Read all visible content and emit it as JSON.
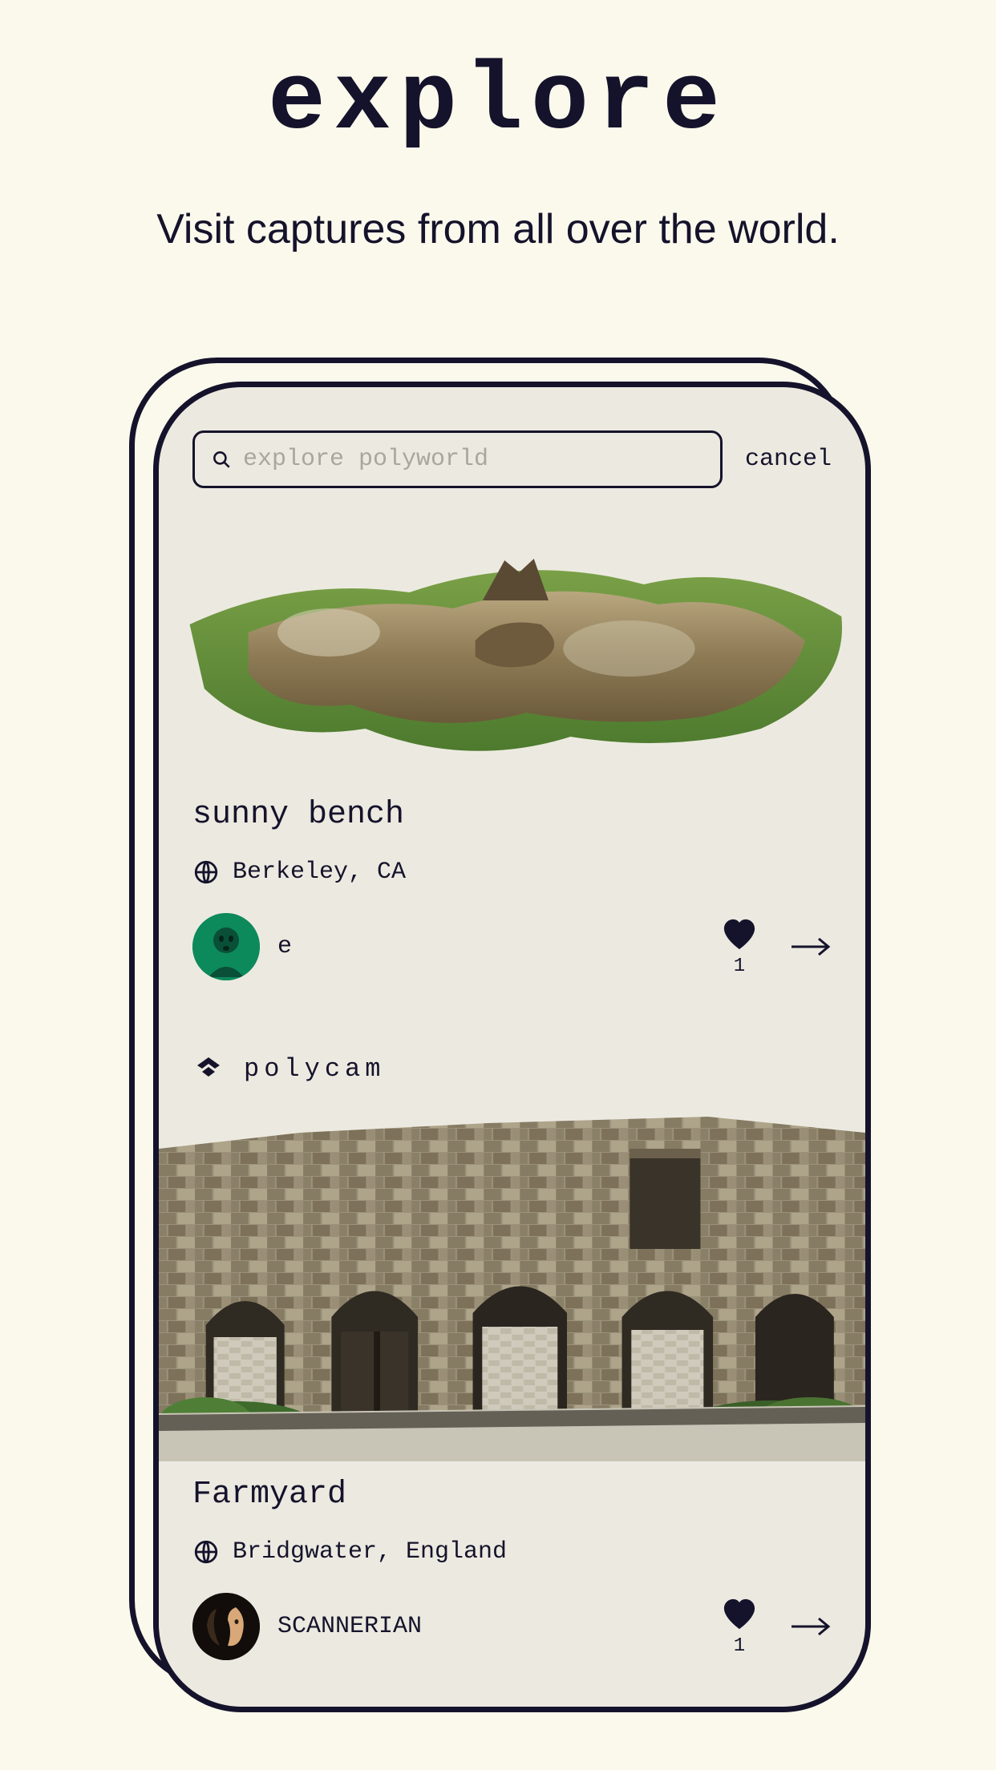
{
  "header": {
    "title": "explore",
    "subtitle": "Visit captures from all over the world."
  },
  "search": {
    "placeholder": "explore polyworld",
    "cancel_label": "cancel"
  },
  "brand": {
    "name": "polycam"
  },
  "captures": [
    {
      "title": "sunny bench",
      "location": "Berkeley, CA",
      "author": "e",
      "likes": "1"
    },
    {
      "title": "Farmyard",
      "location": "Bridgwater, England",
      "author": "SCANNERIAN",
      "likes": "1"
    }
  ]
}
